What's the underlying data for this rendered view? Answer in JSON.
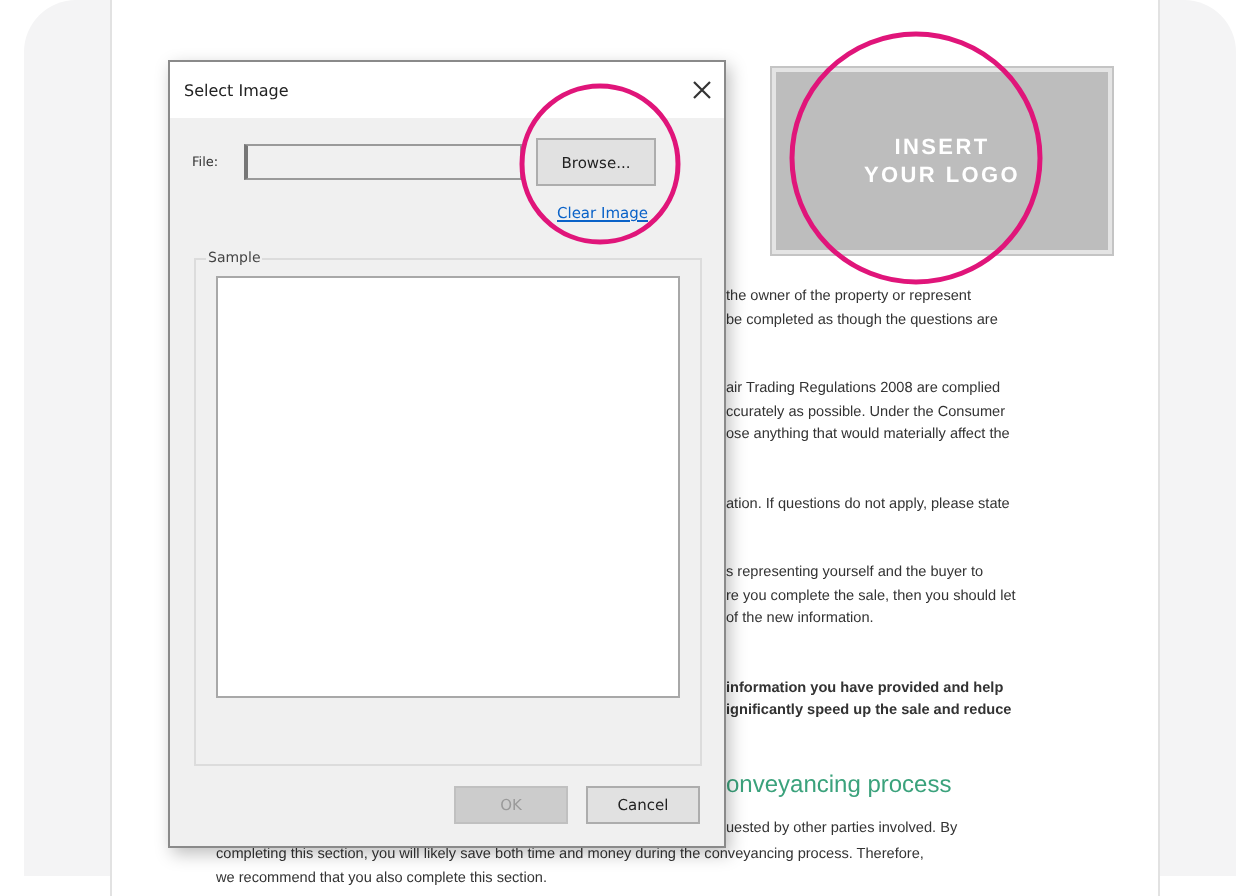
{
  "document": {
    "logo_placeholder": [
      "INSERT",
      "YOUR LOGO"
    ],
    "paragraphs": [
      {
        "kind": "text",
        "lines": [
          "the owner of the property or represent",
          "be completed as though the questions are"
        ]
      },
      {
        "kind": "text",
        "lines": [
          "air Trading Regulations 2008 are complied",
          "ccurately as possible. Under the Consumer",
          "ose anything that would materially affect the"
        ]
      },
      {
        "kind": "text",
        "lines": [
          "ation. If questions do not apply, please state"
        ]
      },
      {
        "kind": "text",
        "lines": [
          "s representing yourself and the buyer to",
          "re you complete the sale, then you should let",
          "of the new information."
        ]
      },
      {
        "kind": "bold",
        "lines": [
          "information you have provided and help",
          "ignificantly speed up the sale and reduce"
        ]
      },
      {
        "kind": "heading",
        "lines": [
          "onveyancing process"
        ]
      },
      {
        "kind": "text",
        "lines": [
          "uested by other parties involved. By"
        ]
      },
      {
        "kind": "full",
        "lines": [
          "completing this section, you will likely save both time and money during the conveyancing process. Therefore,",
          "we recommend that you also complete this section."
        ]
      }
    ]
  },
  "dialog": {
    "title": "Select Image",
    "file_label": "File:",
    "browse_button": "Browse...",
    "clear_link": "Clear Image",
    "sample_label": "Sample",
    "buttons": [
      {
        "label": "OK",
        "disabled": true
      },
      {
        "label": "Cancel",
        "disabled": false
      }
    ]
  }
}
